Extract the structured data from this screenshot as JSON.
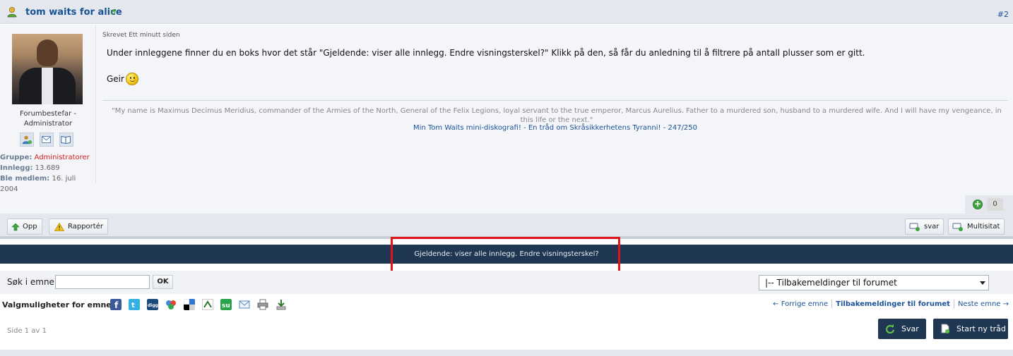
{
  "post": {
    "title": "tom waits for alice",
    "number": "#2",
    "written": "Skrevet Ett minutt siden",
    "message": "Under innleggene finner du en boks hvor det står \"Gjeldende: viser alle innlegg. Endre visningsterskel?\" Klikk på den, så får du anledning til å filtrere på antall plusser som er gitt.",
    "signoff": "Geir",
    "quote": "\"My name is Maximus Decimus Meridius, commander of the Armies of the North, General of the Felix Legions, loyal servant to the true emperor, Marcus Aurelius. Father to a murdered son, husband to a murdered wife. And I will have my vengeance, in this life or the next.\"",
    "sig_link_1": "Min Tom Waits mini-diskografi!",
    "sig_sep": " - ",
    "sig_link_2": "En tråd om Skråsikkerhetens Tyranni! - 247/250",
    "plus_count": "0"
  },
  "author": {
    "role": "Forumbestefar - Administrator",
    "group_label": "Gruppe:",
    "group_value": "Administratorer",
    "posts_label": "Innlegg:",
    "posts_value": "13.689",
    "member_label": "Ble medlem:",
    "member_value": "16. juli 2004"
  },
  "actions": {
    "up": "Opp",
    "report": "Rapportér",
    "reply": "svar",
    "multiquote": "Multisitat"
  },
  "threshold": "Gjeldende: viser alle innlegg. Endre visningsterskel?",
  "search": {
    "label": "Søk i emne:",
    "value": "",
    "ok": "OK"
  },
  "forum_select": "|-- Tilbakemeldinger til forumet",
  "options": {
    "label": "Valgmuligheter for emne:",
    "prev": "← Forrige emne",
    "current": "Tilbakemeldinger til forumet",
    "next": "Neste emne →"
  },
  "page_info": "Side 1 av 1",
  "buttons": {
    "reply": "Svar",
    "new_thread": "Start ny tråd"
  },
  "colors": {
    "link": "#1a5296",
    "dark": "#1f3752",
    "highlight": "#e2141b",
    "admin": "#d42020"
  }
}
